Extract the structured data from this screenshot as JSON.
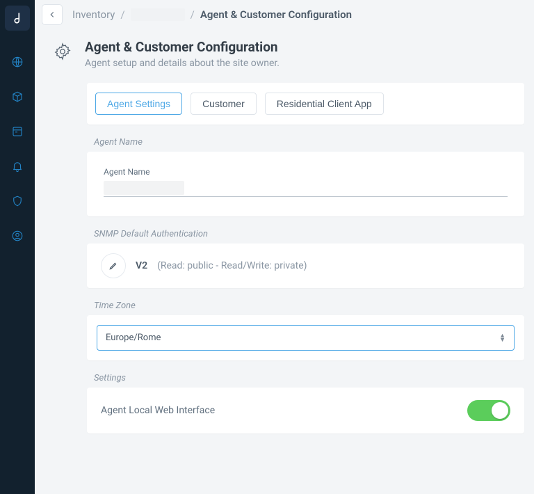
{
  "breadcrumb": {
    "root": "Inventory",
    "current": "Agent & Customer Configuration"
  },
  "header": {
    "title": "Agent & Customer Configuration",
    "subtitle": "Agent setup and details about the site owner."
  },
  "tabs": [
    {
      "label": "Agent Settings",
      "active": true
    },
    {
      "label": "Customer",
      "active": false
    },
    {
      "label": "Residential Client App",
      "active": false
    }
  ],
  "sections": {
    "agentName": {
      "label": "Agent Name",
      "fieldLabel": "Agent Name",
      "value": ""
    },
    "snmp": {
      "label": "SNMP Default Authentication",
      "version": "V2",
      "detail": "(Read: public - Read/Write: private)"
    },
    "timezone": {
      "label": "Time Zone",
      "value": "Europe/Rome"
    },
    "settings": {
      "label": "Settings",
      "item": "Agent Local Web Interface",
      "enabled": true
    }
  }
}
